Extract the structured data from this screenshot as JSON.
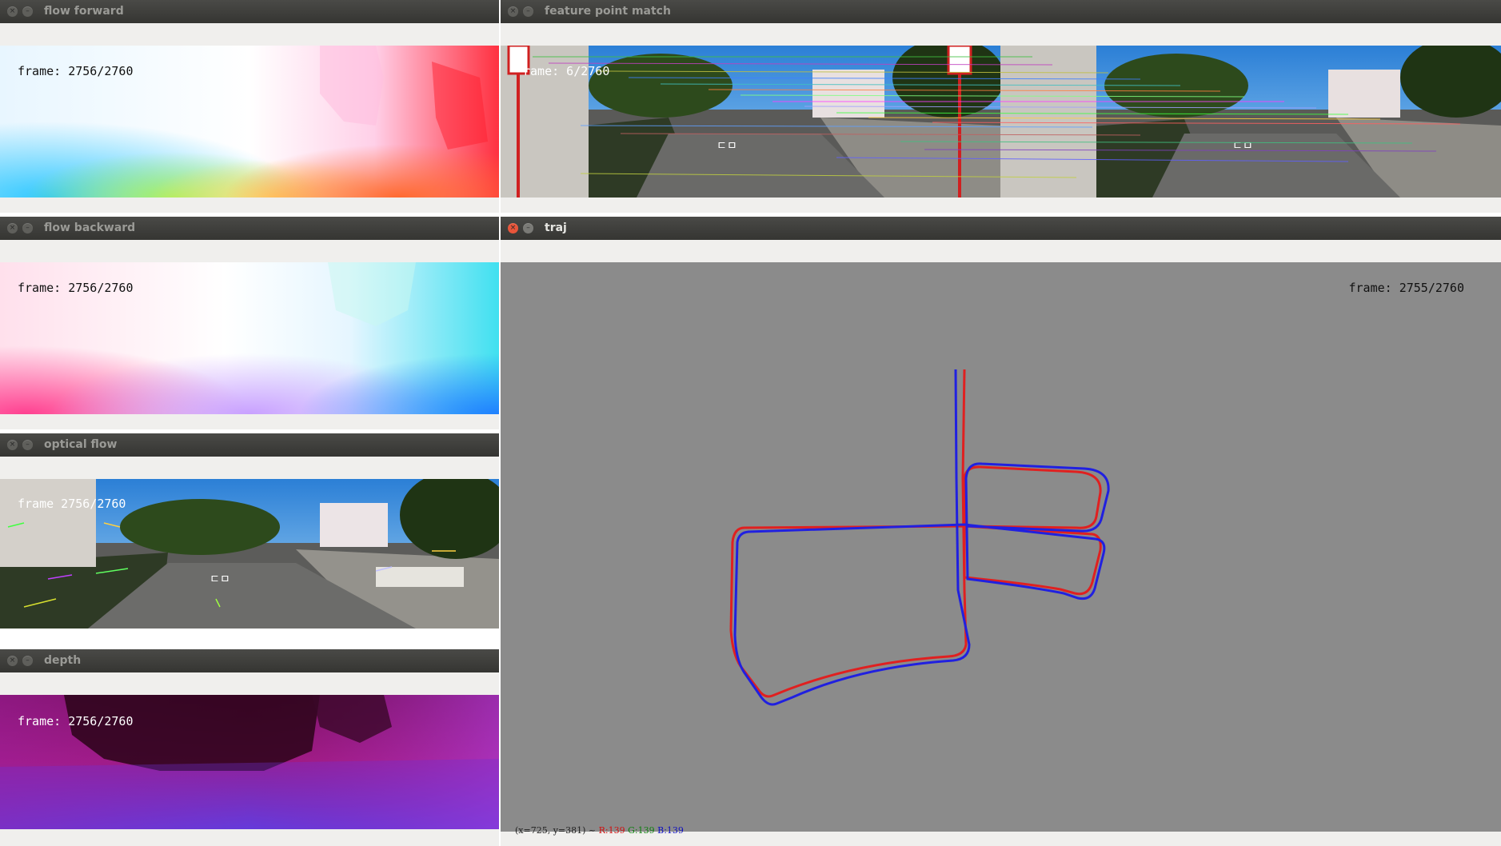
{
  "windows": {
    "flow_forward": {
      "title": "flow forward",
      "frame": "frame: 2756/2760"
    },
    "feature_match": {
      "title": "feature point match",
      "frame": "rame: 6/2760"
    },
    "flow_backward": {
      "title": "flow backward",
      "frame": "frame: 2756/2760"
    },
    "optical_flow": {
      "title": "optical flow",
      "frame": "frame 2756/2760"
    },
    "depth": {
      "title": "depth",
      "frame": "frame: 2756/2760"
    },
    "traj": {
      "title": "traj",
      "frame": "frame: 2755/2760",
      "status_prefix": "(x=725, y=381) ~ ",
      "status_r": "R:139",
      "status_g": "G:139",
      "status_b": "B:139",
      "legend_colors": {
        "ground_truth": "#e02020",
        "estimated": "#2020e0"
      }
    }
  },
  "icons": {
    "close": "close-icon",
    "minimize": "minimize-icon"
  },
  "colors": {
    "titlebar": "#3c3b37",
    "canvas_bg": "#8b8b8b",
    "window_bg": "#f0efed"
  }
}
